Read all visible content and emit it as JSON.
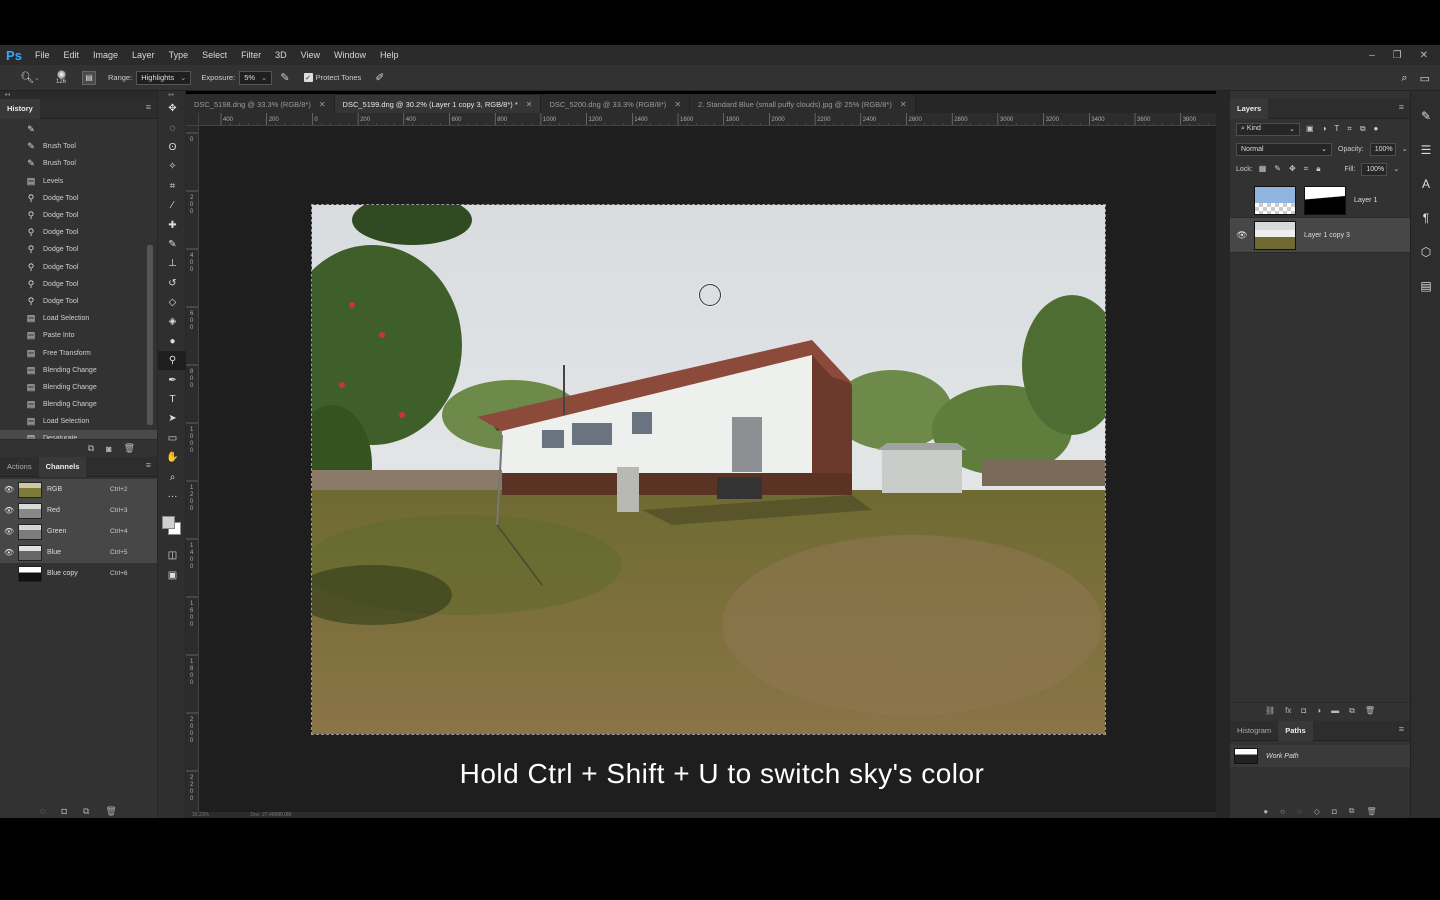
{
  "app": {
    "logo": "Ps"
  },
  "menu": [
    "File",
    "Edit",
    "Image",
    "Layer",
    "Type",
    "Select",
    "Filter",
    "3D",
    "View",
    "Window",
    "Help"
  ],
  "window_controls": [
    "–",
    "❐",
    "✕"
  ],
  "options": {
    "brush_size": "126",
    "range_label": "Range:",
    "range_value": "Highlights",
    "exposure_label": "Exposure:",
    "exposure_value": "5%",
    "protect_tones_label": "Protect Tones"
  },
  "history": {
    "tab_label": "History",
    "items": [
      {
        "label": "",
        "icon": "brush"
      },
      {
        "label": "Brush Tool",
        "icon": "brush"
      },
      {
        "label": "Brush Tool",
        "icon": "brush"
      },
      {
        "label": "Levels",
        "icon": "doc"
      },
      {
        "label": "Dodge Tool",
        "icon": "dodge"
      },
      {
        "label": "Dodge Tool",
        "icon": "dodge"
      },
      {
        "label": "Dodge Tool",
        "icon": "dodge"
      },
      {
        "label": "Dodge Tool",
        "icon": "dodge"
      },
      {
        "label": "Dodge Tool",
        "icon": "dodge"
      },
      {
        "label": "Dodge Tool",
        "icon": "dodge"
      },
      {
        "label": "Dodge Tool",
        "icon": "dodge"
      },
      {
        "label": "Load Selection",
        "icon": "doc"
      },
      {
        "label": "Paste Into",
        "icon": "doc"
      },
      {
        "label": "Free Transform",
        "icon": "doc"
      },
      {
        "label": "Blending Change",
        "icon": "doc"
      },
      {
        "label": "Blending Change",
        "icon": "doc"
      },
      {
        "label": "Blending Change",
        "icon": "doc"
      },
      {
        "label": "Load Selection",
        "icon": "doc"
      },
      {
        "label": "Desaturate",
        "icon": "doc"
      }
    ]
  },
  "channels": {
    "tabs": [
      "Actions",
      "Channels"
    ],
    "items": [
      {
        "name": "RGB",
        "shortcut": "Ctrl+2"
      },
      {
        "name": "Red",
        "shortcut": "Ctrl+3"
      },
      {
        "name": "Green",
        "shortcut": "Ctrl+4"
      },
      {
        "name": "Blue",
        "shortcut": "Ctrl+5"
      },
      {
        "name": "Blue copy",
        "shortcut": "Ctrl+6"
      }
    ]
  },
  "documents": [
    {
      "title": "DSC_5198.dng @ 33.3% (RGB/8*)",
      "active": false
    },
    {
      "title": "DSC_5199.dng @ 30.2% (Layer 1 copy 3, RGB/8*) *",
      "active": true
    },
    {
      "title": "DSC_5200.dng @ 33.3% (RGB/8*)",
      "active": false
    },
    {
      "title": "2. Standard Blue (small puffy clouds).jpg @ 25% (RGB/8*)",
      "active": false
    }
  ],
  "ruler_h_ticks": [
    "400",
    "200",
    "0",
    "200",
    "400",
    "600",
    "800",
    "1000",
    "1200",
    "1400",
    "1600",
    "1800",
    "2000",
    "2200",
    "2400",
    "2600",
    "2800",
    "3000",
    "3200",
    "3400",
    "3600",
    "3800"
  ],
  "ruler_v_ticks": [
    "0",
    "2 0 0",
    "4 0 0",
    "6 0 0",
    "8 0 0",
    "1 0 0 0",
    "1 2 0 0",
    "1 4 0 0",
    "1 6 0 0",
    "1 8 0 0",
    "2 0 0 0",
    "2 2 0 0",
    "2 4 0 0"
  ],
  "status": {
    "zoom": "30.23%",
    "doc": "Doc: 27.4M/80.0M"
  },
  "caption": "Hold Ctrl + Shift + U to switch sky's color",
  "layers": {
    "tab_label": "Layers",
    "kind_label": "Kind",
    "blend_mode": "Normal",
    "opacity_label": "Opacity:",
    "opacity_value": "100%",
    "lock_label": "Lock:",
    "fill_label": "Fill:",
    "fill_value": "100%",
    "items": [
      {
        "name": "Layer 1",
        "visible": false,
        "selected": false
      },
      {
        "name": "Layer 1 copy 3",
        "visible": true,
        "selected": true
      }
    ]
  },
  "paths": {
    "tabs": [
      "Histogram",
      "Paths"
    ],
    "items": [
      {
        "name": "Work Path"
      }
    ]
  },
  "colors": {
    "ps_blue": "#31a8ff",
    "panel_bg": "#323232",
    "canvas_bg": "#1e1e1e"
  }
}
